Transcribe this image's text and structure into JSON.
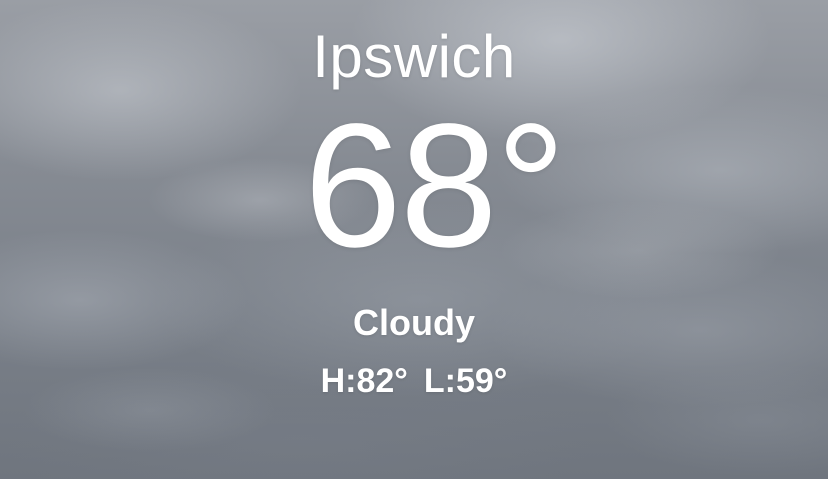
{
  "weather": {
    "city": "Ipswich",
    "temperature": "68°",
    "condition": "Cloudy",
    "high": "H:82°",
    "low": "L:59°"
  },
  "background": {
    "condition_image": "cloudy-sky",
    "base_color": "#7c828b"
  },
  "colors": {
    "text": "#ffffff"
  }
}
